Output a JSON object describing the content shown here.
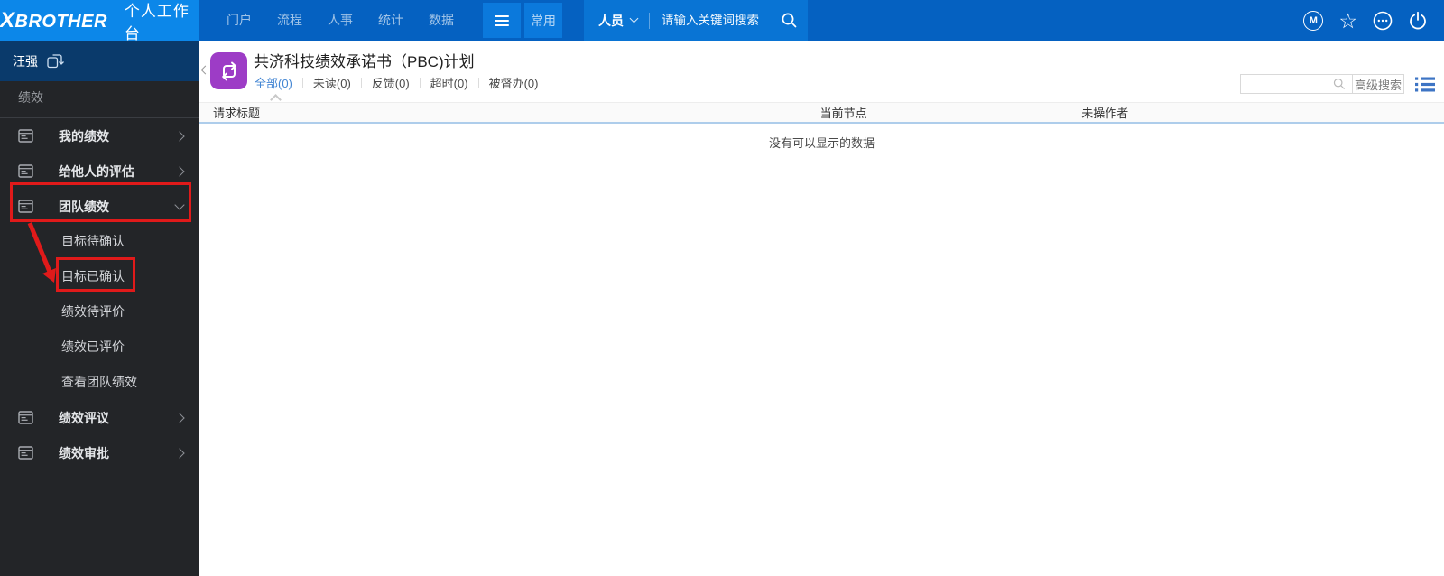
{
  "topbar": {
    "brand": "XBROTHER",
    "product": "个人工作台",
    "nav": [
      "门户",
      "流程",
      "人事",
      "统计",
      "数据"
    ],
    "frequent": "常用",
    "search_category": "人员",
    "search_placeholder": "请输入关键词搜索",
    "m_badge": "M"
  },
  "sidebar": {
    "user": "汪强",
    "section": "绩效",
    "items": [
      "我的绩效",
      "给他人的评估",
      "团队绩效",
      "绩效评议",
      "绩效审批"
    ],
    "subitems": [
      "目标待确认",
      "目标已确认",
      "绩效待评价",
      "绩效已评价",
      "查看团队绩效"
    ]
  },
  "main": {
    "title": "共济科技绩效承诺书（PBC)计划",
    "tabs": [
      "全部(0)",
      "未读(0)",
      "反馈(0)",
      "超时(0)",
      "被督办(0)"
    ],
    "advanced_search": "高级搜索",
    "columns": [
      "请求标题",
      "当前节点",
      "未操作者"
    ],
    "empty": "没有可以显示的数据"
  },
  "colors": {
    "topbar": "#0561c1",
    "topbar_logo": "#0c87e9",
    "topbar_button": "#0b79dc",
    "search_panel": "#0974d4",
    "sidebar_bg": "#232528",
    "sidebar_user_bg": "#0a3a6b",
    "accent_blue": "#4285d3",
    "annotation_red": "#e01a1a",
    "icon_purple": "#9d3cc6",
    "table_head_border": "#aecdeb"
  }
}
